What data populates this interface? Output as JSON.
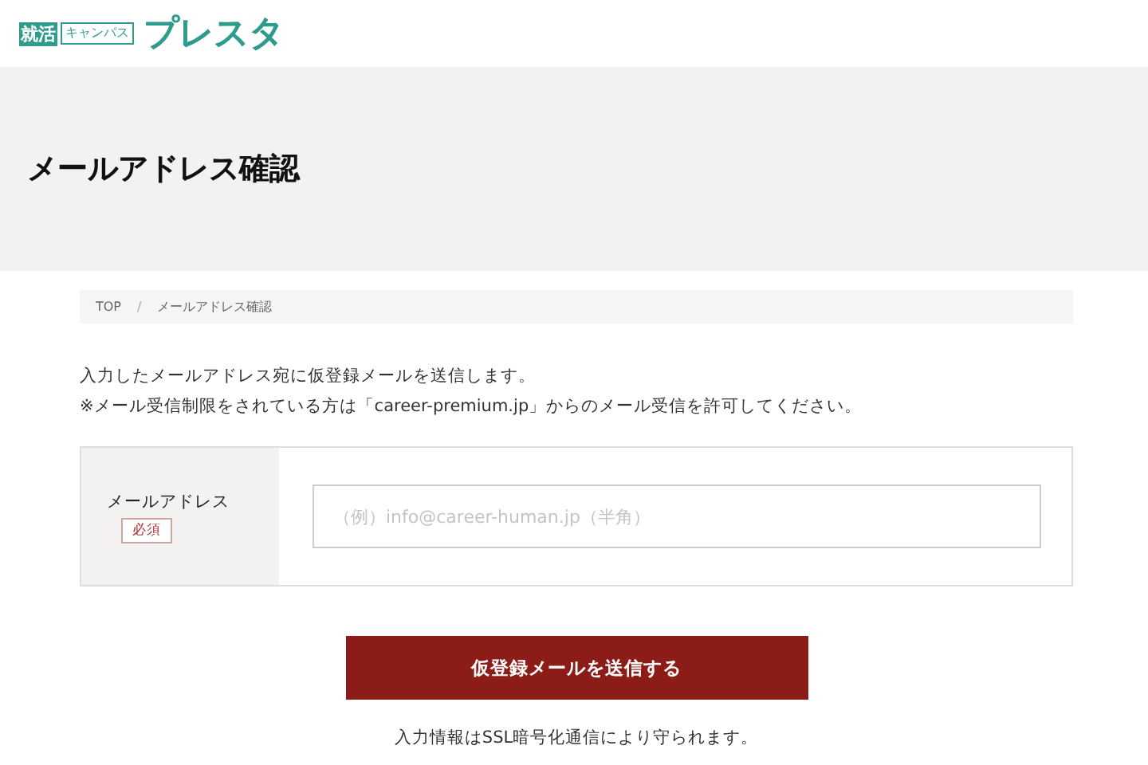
{
  "logo": {
    "badge": "就活",
    "sub": "キャンパス",
    "name": "プレスタ"
  },
  "page_title": "メールアドレス確認",
  "breadcrumb": [
    {
      "label": "TOP"
    },
    {
      "label": "メールアドレス確認"
    }
  ],
  "breadcrumb_separator": "/",
  "intro": [
    "入力したメールアドレス宛に仮登録メールを送信します。",
    "※メール受信制限をされている方は「career-premium.jp」からのメール受信を許可してください。"
  ],
  "form": {
    "label": "メールアドレス",
    "required_badge": "必須",
    "placeholder": "（例）info@career-human.jp（半角）"
  },
  "submit_button": "仮登録メールを送信する",
  "note": "入力情報はSSL暗号化通信により守られます。"
}
